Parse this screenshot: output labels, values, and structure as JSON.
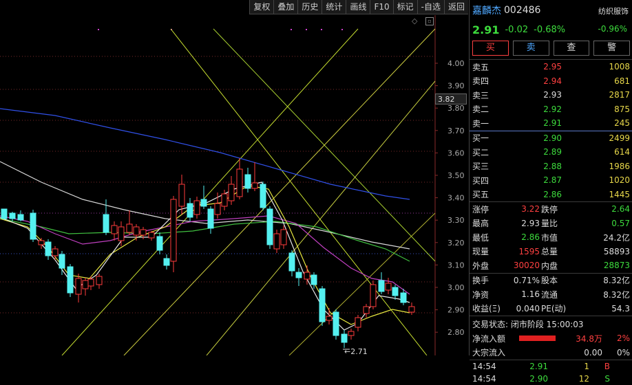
{
  "toolbar": [
    "复权",
    "叠加",
    "历史",
    "统计",
    "画线",
    "F10",
    "标记",
    "-自选",
    "返回"
  ],
  "chart": {
    "price_tag": "3.82",
    "low_marker": "2.71",
    "y_ticks": [
      "4.00",
      "3.90",
      "3.80",
      "3.70",
      "3.60",
      "3.50",
      "3.40",
      "3.30",
      "3.20",
      "3.10",
      "3.00",
      "2.90",
      "2.80"
    ]
  },
  "stock": {
    "name": "嘉麟杰",
    "code": "002486",
    "sector": "纺织服饰",
    "price": "2.91",
    "change": "-0.02",
    "change_pct": "-0.68%",
    "sector_pct": "-0.96%"
  },
  "actions": [
    "买",
    "卖",
    "查",
    "警"
  ],
  "asks": [
    {
      "label": "卖五",
      "price": "2.95",
      "vol": "1008",
      "c": "up"
    },
    {
      "label": "卖四",
      "price": "2.94",
      "vol": "681",
      "c": "up"
    },
    {
      "label": "卖三",
      "price": "2.93",
      "vol": "2817",
      "c": "wht"
    },
    {
      "label": "卖二",
      "price": "2.92",
      "vol": "875",
      "c": "dn"
    },
    {
      "label": "卖一",
      "price": "2.91",
      "vol": "245",
      "c": "dn"
    }
  ],
  "bids": [
    {
      "label": "买一",
      "price": "2.90",
      "vol": "2499",
      "c": "dn"
    },
    {
      "label": "买二",
      "price": "2.89",
      "vol": "614",
      "c": "dn"
    },
    {
      "label": "买三",
      "price": "2.88",
      "vol": "1986",
      "c": "dn"
    },
    {
      "label": "买四",
      "price": "2.87",
      "vol": "1020",
      "c": "dn"
    },
    {
      "label": "买五",
      "price": "2.86",
      "vol": "1445",
      "c": "dn"
    }
  ],
  "stats": [
    {
      "l1": "涨停",
      "v1": "3.22",
      "c1": "up",
      "l2": "跌停",
      "v2": "2.64",
      "c2": "dn"
    },
    {
      "l1": "最高",
      "v1": "2.93",
      "c1": "wht",
      "l2": "量比",
      "v2": "0.57",
      "c2": "dn"
    },
    {
      "l1": "最低",
      "v1": "2.86",
      "c1": "dn",
      "l2": "市值",
      "v2": "24.2亿",
      "c2": "wht"
    },
    {
      "l1": "现量",
      "v1": "1595",
      "c1": "up",
      "l2": "总量",
      "v2": "58893",
      "c2": "wht"
    },
    {
      "l1": "外盘",
      "v1": "30020",
      "c1": "up",
      "l2": "内盘",
      "v2": "28873",
      "c2": "dn"
    }
  ],
  "fundamentals": [
    {
      "l1": "换手",
      "v1": "0.71%",
      "l2": "股本",
      "v2": "8.32亿"
    },
    {
      "l1": "净资",
      "v1": "1.16",
      "l2": "流通",
      "v2": "8.32亿"
    },
    {
      "l1": "收益(Ξ)",
      "v1": "0.040",
      "l2": "PE(动)",
      "v2": "54.3"
    }
  ],
  "status": "交易状态: 闭市阶段 15:00:03",
  "flows": [
    {
      "label": "净流入额",
      "value": "34.8万",
      "pct": "2%",
      "c": "up",
      "bar": 0.75
    },
    {
      "label": "大宗流入",
      "value": "0.00",
      "pct": "0%",
      "c": "wht",
      "bar": 0.0
    }
  ],
  "ticks": [
    {
      "time": "14:54",
      "price": "2.91",
      "vol": "1",
      "side": "B"
    },
    {
      "time": "14:54",
      "price": "2.90",
      "vol": "12",
      "side": "S"
    }
  ]
}
